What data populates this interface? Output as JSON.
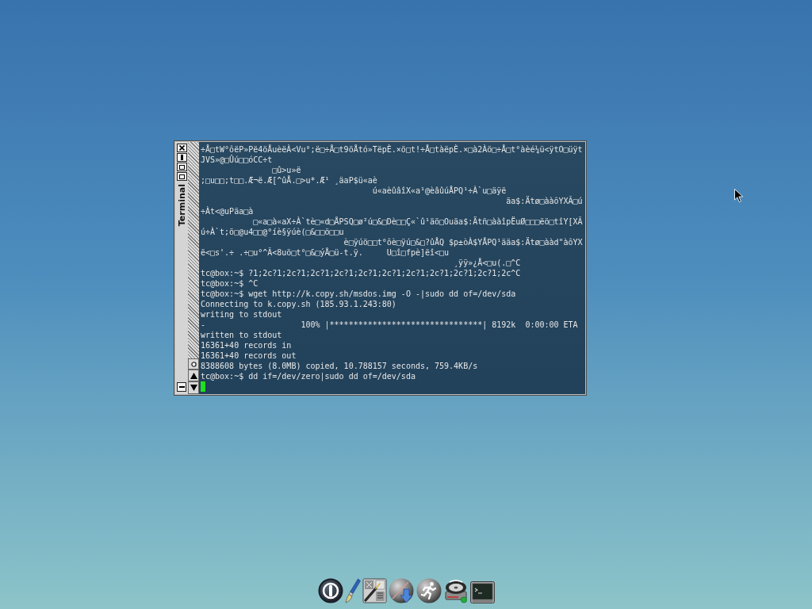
{
  "terminal_window": {
    "title": "Terminal",
    "lines": [
      "÷Å□tW°ôëP»Pë4öÅuèëÀ<Vu°;ë□÷Å□t9öÅtó»TëpÈ.×ö□t!÷Å□tàëpÈ.×□à2Àö□÷Å□t°àèé¼ü<ÿtO□üÿt",
      "JVS»@□Ûú□□óCC÷t",
      "               □û>u»ë",
      ";□u□□;t□□.Æ¬ë.Æ[^ûÅ.□>u*.Æ¹ ¸äaP$ü«aè",
      "                                    ú«aèûâîX«a¹@èâûúÅPQ¹÷À`u□äÿë",
      "                                                                äa$:Ätø□ààôYXÃ□ú",
      "÷Àt<@uPäa□à",
      "           □«a□à«aX÷À`tè□«d□ÅPSQ□ø²ú□&□Dè□□Ç«`û¹äö□Ouäa$:Ätñ□ààîpËuØ□□□ëö□tîY[XÃ",
      "ú÷À`t;ö□@u4□□@°íè§ÿúè(□&□□ö□□u",
      "                              è□ÿúö□□t°ôè□ÿú□&□?ûÅQ $p±òÀ$YÅPQ¹ääa$:Ätø□ààd\"àôYX",
      "ë<□s'.÷ .÷□u°^Ã<8uö□t°□&□ýÅ□ü-t.ÿ.     U□î□fpè]ëî<□u",
      "                                                     ¸ÿÿ»¿Å<□u(.□^C",
      "tc@box:~$ ?1;2c?1;2c?1;2c?1;2c?1;2c?1;2c?1;2c?1;2c?1;2c?1;2c?1;2c^C",
      "tc@box:~$ ^C",
      "tc@box:~$ wget http://k.copy.sh/msdos.img -O -|sudo dd of=/dev/sda",
      "Connecting to k.copy.sh (185.93.1.243:80)",
      "writing to stdout",
      "-                    100% |********************************| 8192k  0:00:00 ETA",
      "written to stdout",
      "16361+40 records in",
      "16361+40 records out",
      "8388608 bytes (8.0MB) copied, 10.788157 seconds, 759.4KB/s",
      "tc@box:~$ dd if=/dev/zero|sudo dd of=/dev/sda"
    ]
  }
}
